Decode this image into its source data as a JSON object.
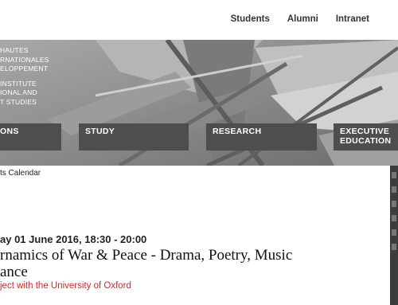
{
  "top_nav": [
    "Students",
    "Alumni",
    "Intranet"
  ],
  "institute_lines_fr": [
    "HAUTES",
    "RNATIONALES",
    "ELOPPEMENT"
  ],
  "institute_lines_en": [
    "INSTITUTE",
    "IONAL AND",
    "T STUDIES"
  ],
  "main_nav": [
    {
      "line1": "ONS",
      "line2": ""
    },
    {
      "line1": "STUDY",
      "line2": ""
    },
    {
      "line1": "RESEARCH",
      "line2": ""
    },
    {
      "line1": "EXECUTIVE",
      "line2": "EDUCATION"
    }
  ],
  "breadcrumb": "ts Calendar",
  "event": {
    "date": "ay 01 June 2016, 18:30 - 20:00",
    "title_line1": "rnamics of War & Peace - Drama, Poetry, Music",
    "title_line2": "ance",
    "subtitle": "ject with the University of Oxford"
  },
  "colors": {
    "nav_bg": "#4e4e4e",
    "hero_bg": "#8f8f8f",
    "accent_red": "#d0282e"
  }
}
